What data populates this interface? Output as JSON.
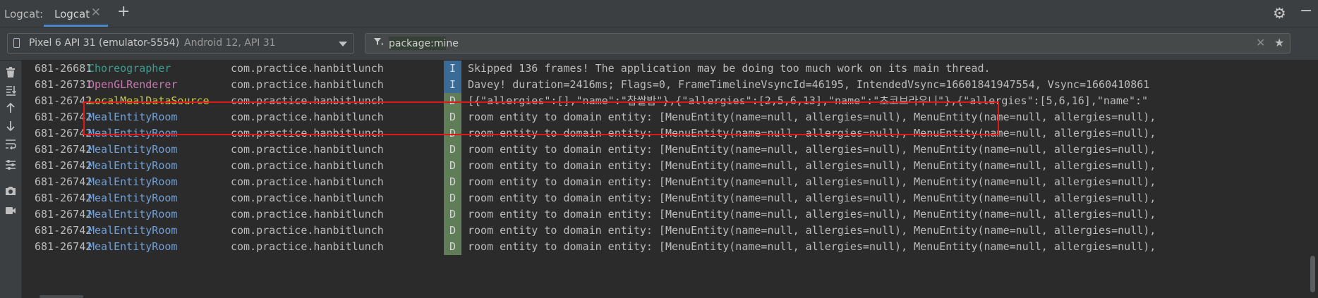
{
  "header": {
    "title": "Logcat:",
    "tab_label": "Logcat",
    "tab_close": "✕",
    "add_tab": "+",
    "settings_icon": "gear-icon",
    "minimize_icon": "minimize-icon"
  },
  "toolbar": {
    "device_name": "Pixel 6 API 31 (emulator-5554)",
    "device_meta": "Android 12, API 31",
    "filter_value": "package:mine",
    "filter_icon": "filter-icon",
    "clear_icon": "close-icon",
    "favorite_icon": "star-icon"
  },
  "sidebar": {
    "tools": [
      {
        "name": "clear-logcat-icon"
      },
      {
        "name": "scroll-to-end-icon"
      },
      {
        "name": "up-arrow-icon"
      },
      {
        "name": "down-arrow-icon"
      },
      {
        "name": "soft-wrap-icon"
      },
      {
        "name": "configure-view-icon"
      },
      {
        "name": "screenshot-icon"
      },
      {
        "name": "screen-record-icon"
      }
    ]
  },
  "colors": {
    "level_info_bg": "#3a6a96",
    "level_debug_bg": "#5f7e57",
    "tag_choreographer": "#3e9c91",
    "tag_opengl": "#c678ae",
    "tag_localmeal": "#c8c84e",
    "tag_mealentity": "#6f9fd6",
    "selection_border": "#e01818"
  },
  "log": {
    "rows": [
      {
        "pid": "681-26681",
        "tag": "Choreographer",
        "pkg": "com.practice.hanbitlunch",
        "level": "I",
        "msg": "Skipped 136 frames!  The application may be doing too much work on its main thread."
      },
      {
        "pid": "681-26731",
        "tag": "OpenGLRenderer",
        "pkg": "com.practice.hanbitlunch",
        "level": "I",
        "msg": "Davey! duration=2416ms; Flags=0, FrameTimelineVsyncId=46195, IntendedVsync=16601841947554, Vsync=1660410861"
      },
      {
        "pid": "681-26742",
        "tag": "LocalMealDataSource",
        "pkg": "com.practice.hanbitlunch",
        "level": "D",
        "msg": "[{\"allergies\":[],\"name\":\"찹쌀밥\"},{\"allergies\":[2,5,6,13],\"name\":\"초코브라우니\"},{\"allergies\":[5,6,16],\"name\":\""
      },
      {
        "pid": "681-26742",
        "tag": "MealEntityRoom",
        "pkg": "com.practice.hanbitlunch",
        "level": "D",
        "msg": "room entity to domain entity: [MenuEntity(name=null, allergies=null), MenuEntity(name=null, allergies=null),"
      },
      {
        "pid": "681-26742",
        "tag": "MealEntityRoom",
        "pkg": "com.practice.hanbitlunch",
        "level": "D",
        "msg": "room entity to domain entity: [MenuEntity(name=null, allergies=null), MenuEntity(name=null, allergies=null),"
      },
      {
        "pid": "681-26742",
        "tag": "MealEntityRoom",
        "pkg": "com.practice.hanbitlunch",
        "level": "D",
        "msg": "room entity to domain entity: [MenuEntity(name=null, allergies=null), MenuEntity(name=null, allergies=null),"
      },
      {
        "pid": "681-26742",
        "tag": "MealEntityRoom",
        "pkg": "com.practice.hanbitlunch",
        "level": "D",
        "msg": "room entity to domain entity: [MenuEntity(name=null, allergies=null), MenuEntity(name=null, allergies=null),"
      },
      {
        "pid": "681-26742",
        "tag": "MealEntityRoom",
        "pkg": "com.practice.hanbitlunch",
        "level": "D",
        "msg": "room entity to domain entity: [MenuEntity(name=null, allergies=null), MenuEntity(name=null, allergies=null),"
      },
      {
        "pid": "681-26742",
        "tag": "MealEntityRoom",
        "pkg": "com.practice.hanbitlunch",
        "level": "D",
        "msg": "room entity to domain entity: [MenuEntity(name=null, allergies=null), MenuEntity(name=null, allergies=null),"
      },
      {
        "pid": "681-26742",
        "tag": "MealEntityRoom",
        "pkg": "com.practice.hanbitlunch",
        "level": "D",
        "msg": "room entity to domain entity: [MenuEntity(name=null, allergies=null), MenuEntity(name=null, allergies=null),"
      },
      {
        "pid": "681-26742",
        "tag": "MealEntityRoom",
        "pkg": "com.practice.hanbitlunch",
        "level": "D",
        "msg": "room entity to domain entity: [MenuEntity(name=null, allergies=null), MenuEntity(name=null, allergies=null),"
      },
      {
        "pid": "681-26742",
        "tag": "MealEntityRoom",
        "pkg": "com.practice.hanbitlunch",
        "level": "D",
        "msg": "room entity to domain entity: [MenuEntity(name=null, allergies=null), MenuEntity(name=null, allergies=null),"
      }
    ]
  }
}
